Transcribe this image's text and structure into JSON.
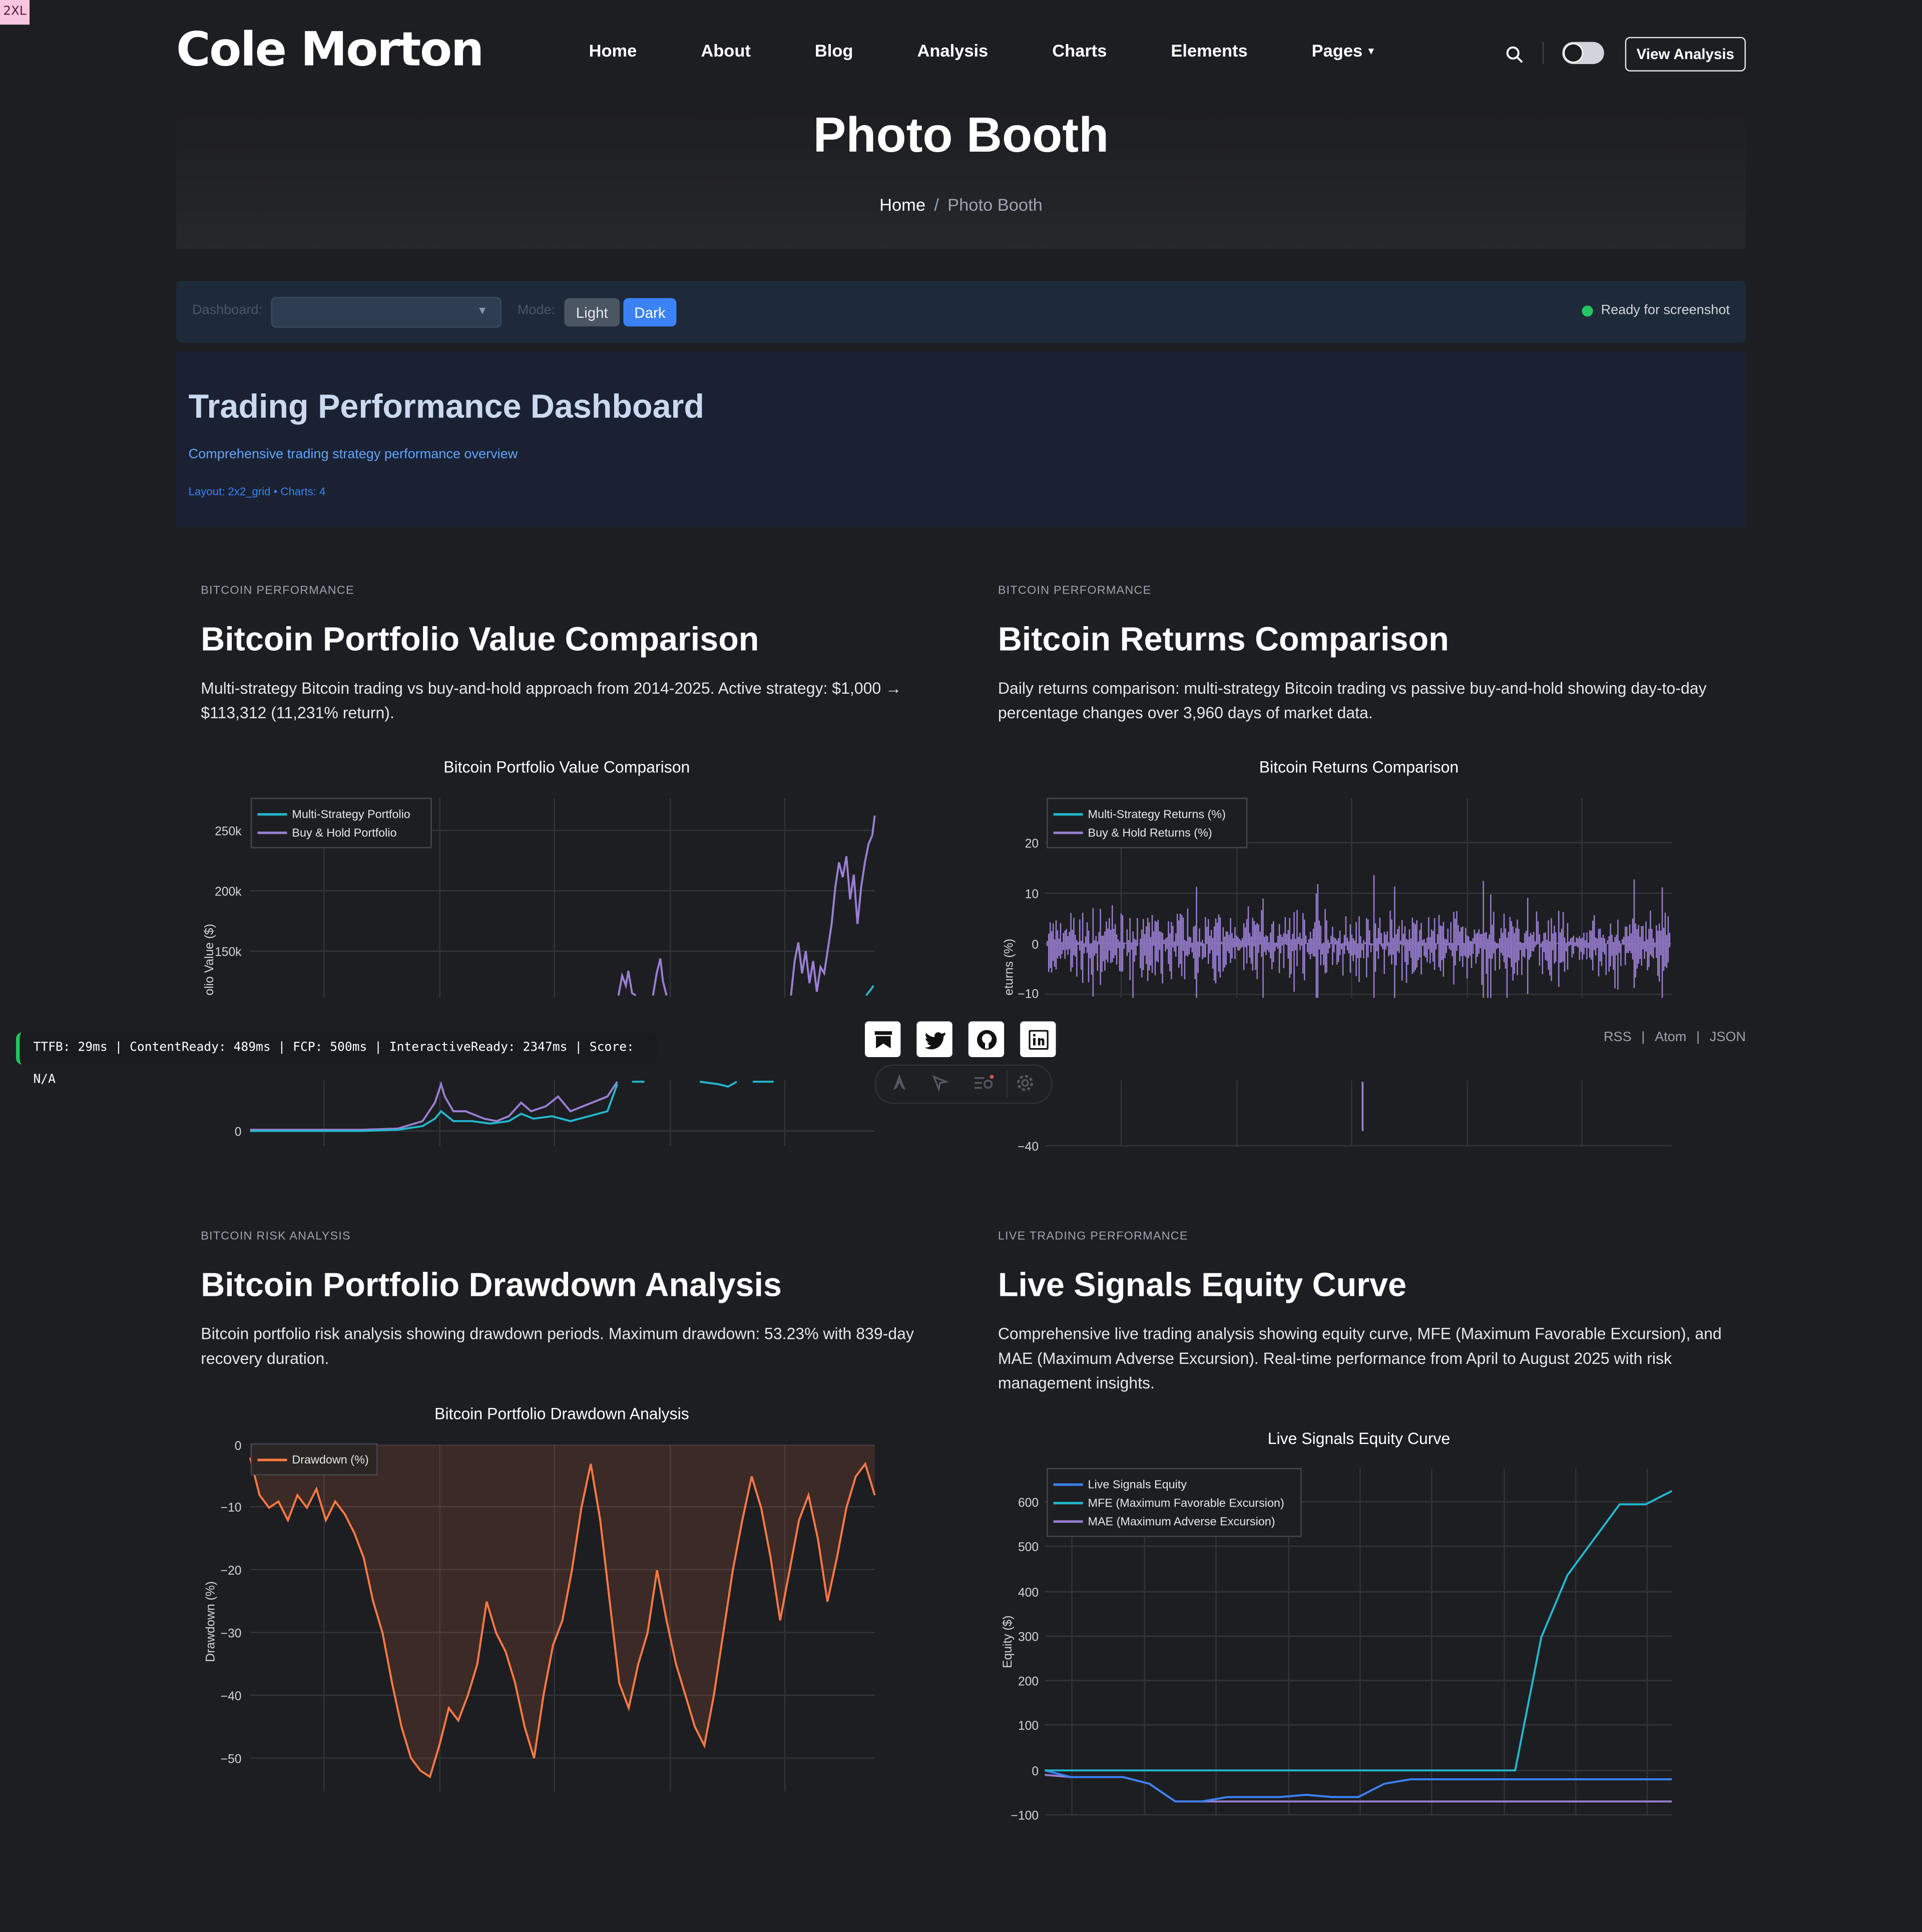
{
  "badge": "2XL",
  "site": {
    "logo": "Cole Morton"
  },
  "nav": {
    "items": [
      "Home",
      "About",
      "Blog",
      "Analysis",
      "Charts",
      "Elements",
      "Pages"
    ],
    "cta": "View Analysis"
  },
  "hero": {
    "title": "Photo Booth",
    "breadcrumb": {
      "home": "Home",
      "sep": "/",
      "current": "Photo Booth"
    }
  },
  "toolbar": {
    "dashboard_label": "Dashboard:",
    "mode_label": "Mode:",
    "mode_light": "Light",
    "mode_dark": "Dark",
    "status": "Ready for screenshot",
    "status_color": "#22c55e"
  },
  "dashboard": {
    "title": "Trading Performance Dashboard",
    "subtitle": "Comprehensive trading strategy performance overview",
    "meta": "Layout: 2x2_grid • Charts: 4"
  },
  "cards": [
    {
      "eyebrow": "BITCOIN PERFORMANCE",
      "title": "Bitcoin Portfolio Value Comparison",
      "desc": "Multi-strategy Bitcoin trading vs buy-and-hold approach from 2014-2025. Active strategy: $1,000 → $113,312 (11,231% return)."
    },
    {
      "eyebrow": "BITCOIN PERFORMANCE",
      "title": "Bitcoin Returns Comparison",
      "desc": "Daily returns comparison: multi-strategy Bitcoin trading vs passive buy-and-hold showing day-to-day percentage changes over 3,960 days of market data."
    },
    {
      "eyebrow": "BITCOIN RISK ANALYSIS",
      "title": "Bitcoin Portfolio Drawdown Analysis",
      "desc": "Bitcoin portfolio risk analysis showing drawdown periods. Maximum drawdown: 53.23% with 839-day recovery duration."
    },
    {
      "eyebrow": "LIVE TRADING PERFORMANCE",
      "title": "Live Signals Equity Curve",
      "desc": "Comprehensive live trading analysis showing equity curve, MFE (Maximum Favorable Excursion), and MAE (Maximum Adverse Excursion). Real-time performance from April to August 2025 with risk management insights."
    }
  ],
  "chart_data": [
    {
      "type": "line",
      "title": "Bitcoin Portfolio Value Comparison",
      "ylabel": "olio Value ($)",
      "yticks": [
        "250k",
        "200k",
        "150k",
        "0"
      ],
      "series": [
        {
          "name": "Multi-Strategy Portfolio",
          "color": "#22b8cf"
        },
        {
          "name": "Buy & Hold Portfolio",
          "color": "#9b7fd4"
        }
      ]
    },
    {
      "type": "line",
      "title": "Bitcoin Returns Comparison",
      "ylabel": "eturns (%)",
      "yticks": [
        "20",
        "10",
        "0",
        "−10",
        "−40"
      ],
      "series": [
        {
          "name": "Multi-Strategy Returns (%)",
          "color": "#22b8cf"
        },
        {
          "name": "Buy & Hold Returns (%)",
          "color": "#9b7fd4"
        }
      ]
    },
    {
      "type": "area",
      "title": "Bitcoin Portfolio Drawdown Analysis",
      "ylabel": "Drawdown (%)",
      "yticks": [
        "0",
        "−10",
        "−20",
        "−30",
        "−40",
        "−50"
      ],
      "ylim": [
        -55,
        0
      ],
      "series": [
        {
          "name": "Drawdown (%)",
          "color": "#ff7a45",
          "values": [
            -2,
            -8,
            -10,
            -9,
            -12,
            -8,
            -10,
            -7,
            -12,
            -9,
            -11,
            -14,
            -18,
            -25,
            -30,
            -38,
            -45,
            -50,
            -52,
            -53,
            -48,
            -42,
            -44,
            -40,
            -35,
            -25,
            -30,
            -33,
            -38,
            -45,
            -50,
            -40,
            -32,
            -28,
            -20,
            -10,
            -3,
            -12,
            -25,
            -38,
            -42,
            -35,
            -30,
            -20,
            -28,
            -35,
            -40,
            -45,
            -48,
            -40,
            -30,
            -20,
            -12,
            -5,
            -10,
            -18,
            -28,
            -20,
            -12,
            -8,
            -15,
            -25,
            -18,
            -10,
            -5,
            -3,
            -8
          ]
        }
      ]
    },
    {
      "type": "line",
      "title": "Live Signals Equity Curve",
      "ylabel": "Equity ($)",
      "yticks": [
        "600",
        "500",
        "400",
        "300",
        "200",
        "100",
        "0",
        "−100"
      ],
      "ylim": [
        -100,
        650
      ],
      "series": [
        {
          "name": "Live Signals Equity",
          "color": "#3b82f6",
          "values": [
            0,
            -15,
            -15,
            -15,
            -30,
            -70,
            -70,
            -60,
            -60,
            -60,
            -55,
            -60,
            -60,
            -30,
            -20,
            -20,
            -20,
            -20,
            -20,
            -20,
            -20,
            -20,
            -20,
            -20,
            -20
          ]
        },
        {
          "name": "MFE (Maximum Favorable Excursion)",
          "color": "#22b8cf",
          "values": [
            0,
            0,
            0,
            0,
            0,
            0,
            0,
            0,
            0,
            0,
            0,
            0,
            0,
            0,
            0,
            0,
            0,
            0,
            0,
            300,
            440,
            520,
            600,
            600,
            630
          ]
        },
        {
          "name": "MAE (Maximum Adverse Excursion)",
          "color": "#9b7fd4",
          "values": [
            -10,
            -15,
            -15,
            -15,
            -30,
            -70,
            -70,
            -70,
            -70,
            -70,
            -70,
            -70,
            -70,
            -70,
            -70,
            -70,
            -70,
            -70,
            -70,
            -70,
            -70,
            -70,
            -70,
            -70,
            -70
          ]
        }
      ]
    }
  ],
  "perf": {
    "text": "TTFB: 29ms | ContentReady: 489ms | FCP: 500ms | InteractiveReady: 2347ms | Score: N/A"
  },
  "feeds": {
    "rss": "RSS",
    "sep": "|",
    "atom": "Atom",
    "json": "JSON"
  }
}
